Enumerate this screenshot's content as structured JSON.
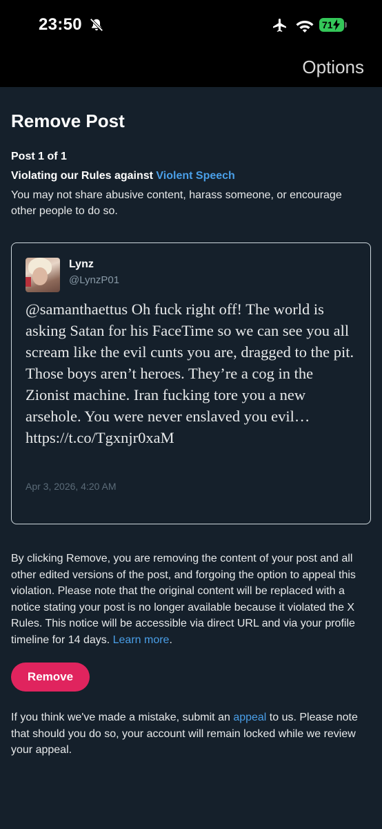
{
  "status_bar": {
    "time": "23:50",
    "battery": "71",
    "icons": [
      "bell-slash-icon",
      "airplane-icon",
      "wifi-icon",
      "battery-icon"
    ],
    "battery_color": "#34c759"
  },
  "header": {
    "options_label": "Options"
  },
  "page": {
    "title": "Remove Post",
    "post_count": "Post 1 of 1",
    "violation_prefix": "Violating our Rules against ",
    "violation_link": "Violent Speech",
    "policy_text": "You may not share abusive content, harass someone, or encourage other people to do so."
  },
  "post": {
    "author_name": "Lynz",
    "author_handle": "@LynzP01",
    "text": "@samanthaettus Oh fuck right off! The world is asking Satan for his FaceTime so we can see you all scream like the evil cunts you are, dragged to the pit. Those boys aren’t heroes. They’re a cog in the Zionist machine. Iran fucking tore you a new arsehole. You were never enslaved you evil… https://t.co/Tgxnjr0xaM",
    "date": "Apr 3, 2026, 4:20 AM"
  },
  "disclaimer": {
    "text": "By clicking Remove, you are removing the content of your post and all other edited versions of the post, and forgoing the option to appeal this violation. Please note that the original content will be replaced with a notice stating your post is no longer available because it violated the X Rules. This notice will be accessible via direct URL and via your profile timeline for 14 days. ",
    "learn_more": "Learn more",
    "period": "."
  },
  "remove_button": {
    "label": "Remove",
    "color": "#e0245e"
  },
  "appeal": {
    "prefix": "If you think we've made a mistake, submit an ",
    "link": "appeal",
    "suffix": " to us. Please note that should you do so, your account will remain locked while we review your appeal."
  },
  "colors": {
    "background": "#15202b",
    "link": "#4a9fe8",
    "bar": "#000000"
  }
}
